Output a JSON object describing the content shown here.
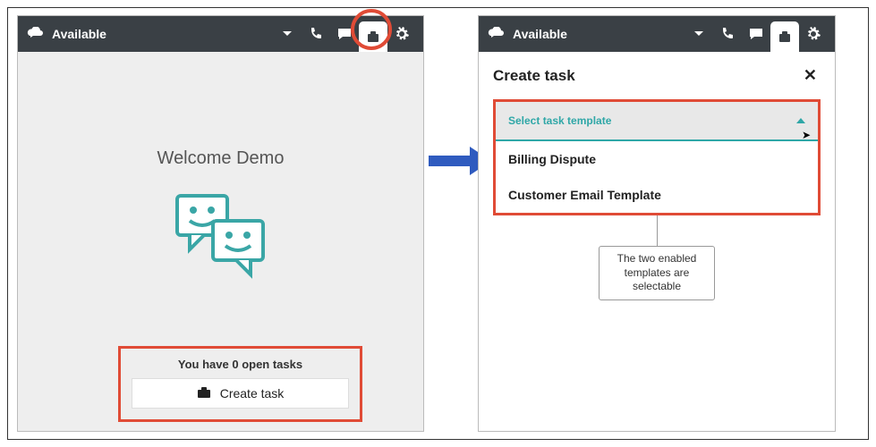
{
  "left": {
    "status": "Available",
    "welcome": "Welcome Demo",
    "open_tasks_prefix": "You have ",
    "open_tasks_count": "0",
    "open_tasks_suffix": " open tasks",
    "create_button": "Create task"
  },
  "right": {
    "status": "Available",
    "title": "Create task",
    "select_placeholder": "Select task template",
    "options": [
      "Billing Dispute",
      "Customer Email Template"
    ],
    "callout": "The two enabled templates are selectable"
  }
}
